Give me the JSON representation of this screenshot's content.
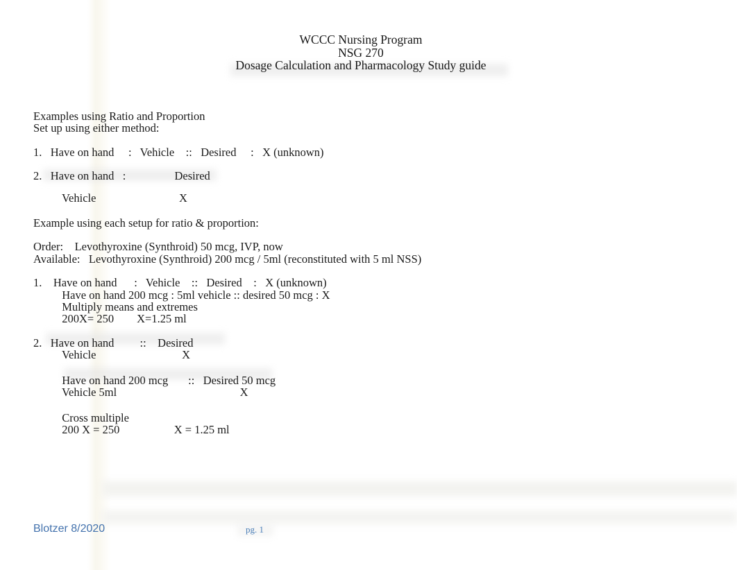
{
  "document": {
    "header": {
      "lines": [
        "WCCC Nursing Program",
        "NSG 270",
        "Dosage Calculation and Pharmacology Study guide"
      ]
    },
    "body": {
      "intro": {
        "line1": "Examples using Ratio and Proportion",
        "line2": "Set up using either method:"
      },
      "method1": {
        "line1": "1.   Have on hand     :   Vehicle    ::   Desired     :   X (unknown)"
      },
      "method2": {
        "line1": "2.   Have on hand   :                 Desired",
        "line2": "          Vehicle                             X"
      },
      "example_intro": "Example using each setup for ratio & proportion:",
      "order": {
        "order_line": "Order:    Levothyroxine (Synthroid) 50 mcg, IVP, now",
        "available_line": "Available:   Levothyroxine (Synthroid) 200 mcg / 5ml (reconstituted with 5 ml NSS)"
      },
      "worked1": {
        "line1": "1.    Have on hand      :   Vehicle    ::   Desired    :   X (unknown)",
        "line2": "          Have on hand 200 mcg : 5ml vehicle :: desired 50 mcg : X",
        "line3": "          Multiply means and extremes",
        "line4": "          200X= 250        X=1.25 ml"
      },
      "worked2": {
        "line1": "2.   Have on hand         ::    Desired",
        "line2": "          Vehicle                              X",
        "line3": "          Have on hand 200 mcg       ::   Desired 50 mcg",
        "line4": "          Vehicle 5ml                                           X",
        "line5": "          Cross multiple",
        "line6": "          200 X = 250                   X = 1.25 ml"
      }
    },
    "footer": {
      "author": "Blotzer 8/2020",
      "page_label": "pg. 1"
    },
    "colors": {
      "footer_author_blue": "#4372ad",
      "footer_page_blue": "#4c7fb8",
      "body_text": "#1a1a1a",
      "page_background": "#ffffff"
    }
  }
}
